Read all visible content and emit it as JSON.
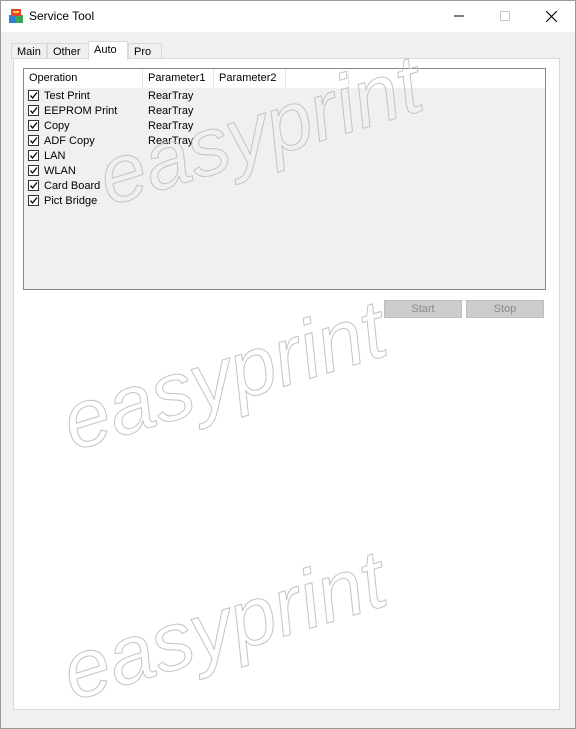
{
  "window": {
    "title": "Service Tool"
  },
  "tabs": [
    {
      "label": "Main"
    },
    {
      "label": "Other"
    },
    {
      "label": "Auto"
    },
    {
      "label": "Pro"
    }
  ],
  "list": {
    "columns": [
      "Operation",
      "Parameter1",
      "Parameter2",
      "",
      ""
    ],
    "rows": [
      {
        "label": "Test Print",
        "param1": "RearTray",
        "checked": true
      },
      {
        "label": "EEPROM Print",
        "param1": "RearTray",
        "checked": true
      },
      {
        "label": "Copy",
        "param1": "RearTray",
        "checked": true
      },
      {
        "label": "ADF Copy",
        "param1": "RearTray",
        "checked": true
      },
      {
        "label": "LAN",
        "param1": "",
        "checked": true
      },
      {
        "label": "WLAN",
        "param1": "",
        "checked": true
      },
      {
        "label": "Card Board",
        "param1": "",
        "checked": true
      },
      {
        "label": "Pict Bridge",
        "param1": "",
        "checked": true
      }
    ]
  },
  "buttons": {
    "start_label": "Start",
    "stop_label": "Stop"
  },
  "watermark": {
    "text": "easyprint"
  },
  "colors": {
    "titlebar": "#ffffff",
    "window_bg": "#f0f0f0",
    "disabled_button": "#cccccc"
  }
}
